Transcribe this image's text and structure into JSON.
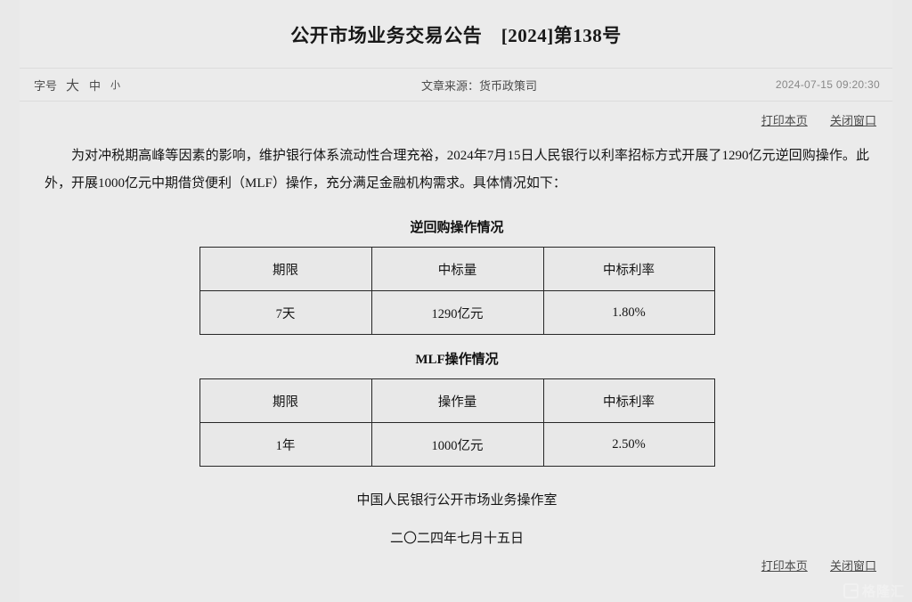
{
  "document": {
    "title": "公开市场业务交易公告　[2024]第138号"
  },
  "meta": {
    "fontsize_label": "字号",
    "fontsize_large": "大",
    "fontsize_medium": "中",
    "fontsize_small": "小",
    "source": "文章来源：货币政策司",
    "timestamp": "2024-07-15 09:20:30"
  },
  "actions": {
    "print": "打印本页",
    "close": "关闭窗口"
  },
  "body": {
    "paragraph": "为对冲税期高峰等因素的影响，维护银行体系流动性合理充裕，2024年7月15日人民银行以利率招标方式开展了1290亿元逆回购操作。此外，开展1000亿元中期借贷便利（MLF）操作，充分满足金融机构需求。具体情况如下："
  },
  "reverse_repo": {
    "section_title": "逆回购操作情况",
    "headers": [
      "期限",
      "中标量",
      "中标利率"
    ],
    "rows": [
      [
        "7天",
        "1290亿元",
        "1.80%"
      ]
    ]
  },
  "mlf": {
    "section_title": "MLF操作情况",
    "headers": [
      "期限",
      "操作量",
      "中标利率"
    ],
    "rows": [
      [
        "1年",
        "1000亿元",
        "2.50%"
      ]
    ]
  },
  "signature": {
    "issuer": "中国人民银行公开市场业务操作室",
    "date": "二〇二四年七月十五日"
  },
  "watermark": {
    "text": "格隆汇"
  },
  "colors": {
    "page_background": "#e9e9e9",
    "table_border": "#262626",
    "link": "#4a4a4a"
  }
}
